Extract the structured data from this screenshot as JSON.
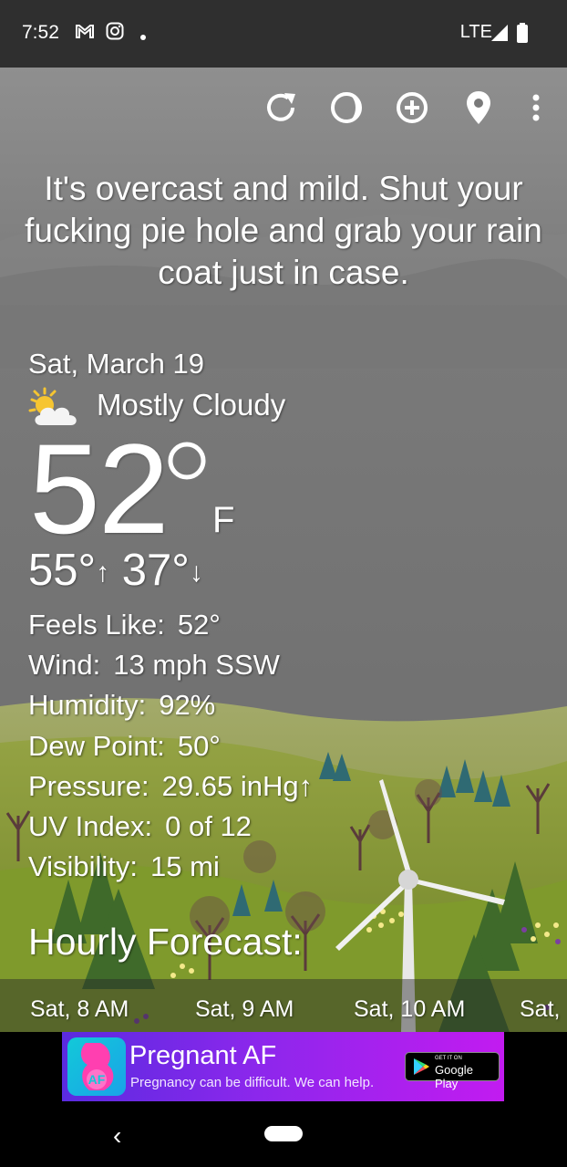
{
  "status_bar": {
    "time": "7:52",
    "network": "LTE",
    "icons": [
      "gmail-icon",
      "instagram-icon",
      "dot-icon",
      "signal-icon",
      "battery-icon"
    ]
  },
  "toolbar": {
    "icons": [
      "refresh-icon",
      "theme-icon",
      "add-location-icon",
      "location-pin-icon",
      "more-vert-icon"
    ]
  },
  "headline": "It's overcast and mild. Shut your fucking pie hole and grab your rain coat just in case.",
  "current": {
    "date": "Sat, March 19",
    "condition": "Mostly Cloudy",
    "condition_icon": "partly-cloudy-icon",
    "temperature": "52",
    "unit": "F",
    "high": "55°",
    "low": "37°",
    "high_arrow": "↑",
    "low_arrow": "↓"
  },
  "details": [
    {
      "label": "Feels Like:",
      "value": "52°"
    },
    {
      "label": "Wind:",
      "value": "13 mph SSW"
    },
    {
      "label": "Humidity:",
      "value": "92%"
    },
    {
      "label": "Dew Point:",
      "value": "50°"
    },
    {
      "label": "Pressure:",
      "value": "29.65 inHg↑"
    },
    {
      "label": "UV Index:",
      "value": "0 of 12"
    },
    {
      "label": "Visibility:",
      "value": "15 mi"
    }
  ],
  "hourly": {
    "title": "Hourly Forecast:",
    "items": [
      "Sat, 8 AM",
      "Sat, 9 AM",
      "Sat, 10 AM",
      "Sat,"
    ]
  },
  "ad": {
    "title": "Pregnant AF",
    "subtitle": "Pregnancy can be difficult. We can help.",
    "store_small": "GET IT ON",
    "store_big": "Google Play",
    "colors": {
      "gradient_start": "#5a2be0",
      "gradient_end": "#c21bf0",
      "logo": "#12c9d8"
    }
  },
  "nav_bar": {
    "back": "‹"
  },
  "colors": {
    "sky": "#737373",
    "hill": "#8a9a3c",
    "status_bar": "#2f2f2f"
  }
}
